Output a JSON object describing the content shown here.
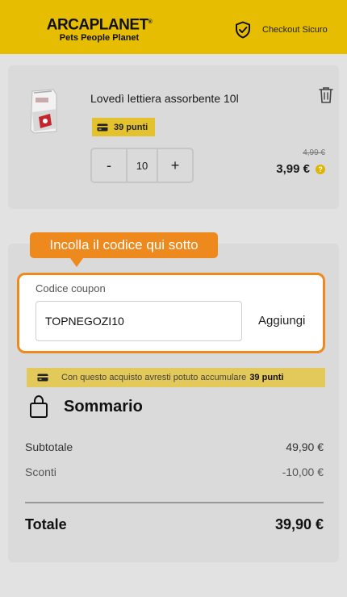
{
  "header": {
    "logo_main": "ARCAPLANET",
    "logo_tm": "®",
    "logo_sub": "Pets People Planet",
    "secure_label": "Checkout Sicuro"
  },
  "product": {
    "name": "Lovedì lettiera assorbente 10l",
    "points": "39 punti",
    "quantity": "10",
    "minus": "-",
    "plus": "+",
    "old_price": "4,99 €",
    "price": "3,99 €",
    "help_glyph": "?"
  },
  "coupon": {
    "tooltip": "Incolla il codice qui sotto",
    "label": "Codice coupon",
    "value": "TOPNEGOZI10",
    "add_label": "Aggiungi"
  },
  "points_banner": {
    "text": "Con questo acquisto avresti potuto accumulare",
    "points": "39 punti"
  },
  "summary": {
    "title": "Sommario",
    "subtotal_label": "Subtotale",
    "subtotal_value": "49,90 €",
    "discount_label": "Sconti",
    "discount_value": "-10,00 €",
    "total_label": "Totale",
    "total_value": "39,90 €"
  },
  "colors": {
    "brand_yellow": "#e6bd00",
    "accent_orange": "#ee8a1d",
    "points_yellow": "#e3c22e"
  },
  "icons": [
    "shield-check-icon",
    "trash-icon",
    "card-icon",
    "help-icon",
    "bag-icon"
  ]
}
